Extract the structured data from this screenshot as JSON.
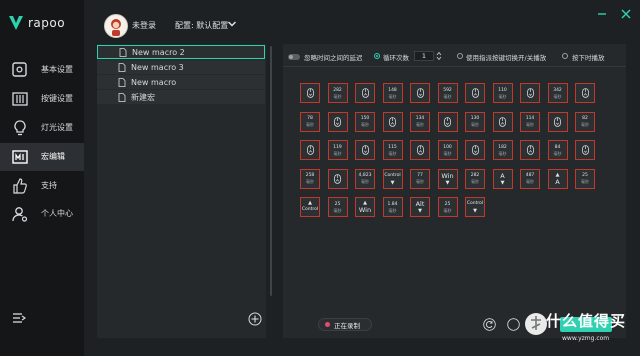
{
  "brand": {
    "name": "rapoo",
    "accent": "#2fd1b1",
    "alert": "#c0392b",
    "record_dot": "#e84a6b"
  },
  "sidebar": {
    "items": [
      {
        "label": "基本设置",
        "icon": "settings-box-icon"
      },
      {
        "label": "按键设置",
        "icon": "keys-sliders-icon"
      },
      {
        "label": "灯光设置",
        "icon": "lightbulb-icon"
      },
      {
        "label": "宏编辑",
        "icon": "macro-editor-icon",
        "active": true
      },
      {
        "label": "支持",
        "icon": "thumbs-up-icon"
      },
      {
        "label": "个人中心",
        "icon": "user-settings-icon"
      }
    ],
    "collapse_icon": "menu-collapse-icon"
  },
  "header": {
    "user": "未登录",
    "config": "配置: 默认配置",
    "window_icons": [
      "minimize-icon",
      "close-icon"
    ]
  },
  "macros": {
    "items": [
      {
        "label": "New macro 2",
        "selected": true
      },
      {
        "label": "New macro 3"
      },
      {
        "label": "New macro"
      },
      {
        "label": "新建宏"
      }
    ],
    "add_icon": "add-circle-icon"
  },
  "options": {
    "ignore_delay": "忽略时间之间的延迟",
    "loop_count_label": "循环次数",
    "loop_count": "1",
    "toggle_playback": "使用指派按键切换开/关播放",
    "hold_playback": "按下时播放"
  },
  "unit": "毫秒",
  "grid": {
    "rows": [
      [
        {
          "kind": "mouse",
          "dir": "down"
        },
        {
          "kind": "delay",
          "value": "282"
        },
        {
          "kind": "mouse",
          "dir": "up"
        },
        {
          "kind": "delay",
          "value": "148"
        },
        {
          "kind": "mouse",
          "dir": "down"
        },
        {
          "kind": "delay",
          "value": "592"
        },
        {
          "kind": "mouse",
          "dir": "up"
        },
        {
          "kind": "delay",
          "value": "110"
        },
        {
          "kind": "mouse",
          "dir": "down"
        },
        {
          "kind": "delay",
          "value": "342"
        },
        {
          "kind": "mouse",
          "dir": "up"
        }
      ],
      [
        {
          "kind": "delay",
          "value": "78"
        },
        {
          "kind": "mouse",
          "dir": "down"
        },
        {
          "kind": "delay",
          "value": "150"
        },
        {
          "kind": "mouse",
          "dir": "up"
        },
        {
          "kind": "delay",
          "value": "134"
        },
        {
          "kind": "mouse",
          "dir": "down"
        },
        {
          "kind": "delay",
          "value": "130"
        },
        {
          "kind": "mouse",
          "dir": "up"
        },
        {
          "kind": "delay",
          "value": "114"
        },
        {
          "kind": "mouse",
          "dir": "down"
        },
        {
          "kind": "delay",
          "value": "82"
        }
      ],
      [
        {
          "kind": "mouse",
          "dir": "up"
        },
        {
          "kind": "delay",
          "value": "119"
        },
        {
          "kind": "mouse",
          "dir": "down"
        },
        {
          "kind": "delay",
          "value": "115"
        },
        {
          "kind": "mouse",
          "dir": "up"
        },
        {
          "kind": "delay",
          "value": "100"
        },
        {
          "kind": "mouse",
          "dir": "down"
        },
        {
          "kind": "delay",
          "value": "182"
        },
        {
          "kind": "mouse",
          "dir": "up"
        },
        {
          "kind": "delay",
          "value": "84"
        },
        {
          "kind": "mouse",
          "dir": "down"
        }
      ],
      [
        {
          "kind": "delay",
          "value": "258"
        },
        {
          "kind": "mouse",
          "dir": "up"
        },
        {
          "kind": "delay",
          "value": "4,823"
        },
        {
          "kind": "key",
          "label": "Control",
          "dir": "down"
        },
        {
          "kind": "delay",
          "value": "77"
        },
        {
          "kind": "key",
          "label": "Win",
          "dir": "down"
        },
        {
          "kind": "delay",
          "value": "282"
        },
        {
          "kind": "key",
          "label": "A",
          "dir": "down"
        },
        {
          "kind": "delay",
          "value": "487"
        },
        {
          "kind": "key",
          "label": "A",
          "dir": "up"
        },
        {
          "kind": "delay",
          "value": "25"
        }
      ],
      [
        {
          "kind": "key",
          "label": "Control",
          "dir": "up"
        },
        {
          "kind": "delay",
          "value": "25"
        },
        {
          "kind": "key",
          "label": "Win",
          "dir": "up"
        },
        {
          "kind": "delay",
          "value": "1.84"
        },
        {
          "kind": "key",
          "label": "Alt",
          "dir": "down"
        },
        {
          "kind": "delay",
          "value": "25"
        },
        {
          "kind": "key",
          "label": "Control",
          "dir": "down"
        }
      ]
    ]
  },
  "footer": {
    "record_label": "正在录制",
    "icons": [
      "refresh-icon",
      "redo-icon"
    ]
  },
  "watermark": {
    "text": "什么值得买",
    "url": "www.yzmg.com"
  }
}
